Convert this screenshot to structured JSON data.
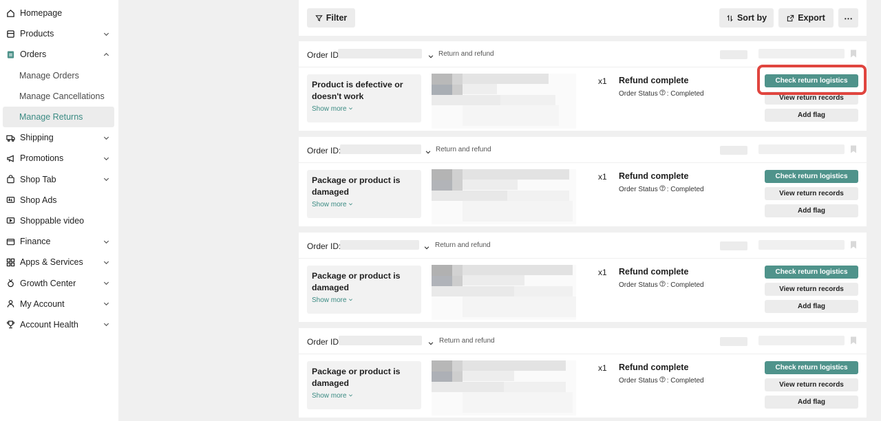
{
  "sidebar": {
    "items": [
      {
        "label": "Homepage",
        "icon": "home-icon",
        "expandable": false
      },
      {
        "label": "Products",
        "icon": "box-icon",
        "expandable": true
      },
      {
        "label": "Orders",
        "icon": "clipboard-icon",
        "expandable": true,
        "expanded": true,
        "children": [
          {
            "label": "Manage Orders",
            "active": false
          },
          {
            "label": "Manage Cancellations",
            "active": false
          },
          {
            "label": "Manage Returns",
            "active": true
          }
        ]
      },
      {
        "label": "Shipping",
        "icon": "truck-icon",
        "expandable": true
      },
      {
        "label": "Promotions",
        "icon": "megaphone-icon",
        "expandable": true
      },
      {
        "label": "Shop Tab",
        "icon": "bag-icon",
        "expandable": true
      },
      {
        "label": "Shop Ads",
        "icon": "ads-icon",
        "expandable": false
      },
      {
        "label": "Shoppable video",
        "icon": "video-icon",
        "expandable": false
      },
      {
        "label": "Finance",
        "icon": "wallet-icon",
        "expandable": true
      },
      {
        "label": "Apps & Services",
        "icon": "apps-icon",
        "expandable": true
      },
      {
        "label": "Growth Center",
        "icon": "medal-icon",
        "expandable": true
      },
      {
        "label": "My Account",
        "icon": "user-icon",
        "expandable": true
      },
      {
        "label": "Account Health",
        "icon": "trophy-icon",
        "expandable": true
      }
    ]
  },
  "toolbar": {
    "filter_label": "Filter",
    "sort_label": "Sort by",
    "export_label": "Export",
    "more_label": "⋯"
  },
  "orders": [
    {
      "order_id_label": "Order ID",
      "tag": "Return and refund",
      "reason": "Product is defective or doesn't work",
      "show_more": "Show more",
      "quantity": "x1",
      "status_title": "Refund complete",
      "order_status_label": "Order Status",
      "order_status_value": ": Completed",
      "actions": [
        "Check return logistics",
        "View return records",
        "Add flag"
      ]
    },
    {
      "order_id_label": "Order ID:",
      "tag": "Return and refund",
      "reason": "Package or product is damaged",
      "show_more": "Show more",
      "quantity": "x1",
      "status_title": "Refund complete",
      "order_status_label": "Order Status",
      "order_status_value": ": Completed",
      "actions": [
        "Check return logistics",
        "View return records",
        "Add flag"
      ]
    },
    {
      "order_id_label": "Order ID:",
      "tag": "Return and refund",
      "reason": "Package or product is damaged",
      "show_more": "Show more",
      "quantity": "x1",
      "status_title": "Refund complete",
      "order_status_label": "Order Status",
      "order_status_value": ": Completed",
      "actions": [
        "Check return logistics",
        "View return records",
        "Add flag"
      ]
    },
    {
      "order_id_label": "Order ID:",
      "tag": "Return and refund",
      "reason": "Package or product is damaged",
      "show_more": "Show more",
      "quantity": "x1",
      "status_title": "Refund complete",
      "order_status_label": "Order Status",
      "order_status_value": ": Completed",
      "actions": [
        "Check return logistics",
        "View return records",
        "Add flag"
      ]
    }
  ],
  "colors": {
    "accent": "#4f938b",
    "active_text": "#3b8b83",
    "highlight": "#e0453f"
  }
}
